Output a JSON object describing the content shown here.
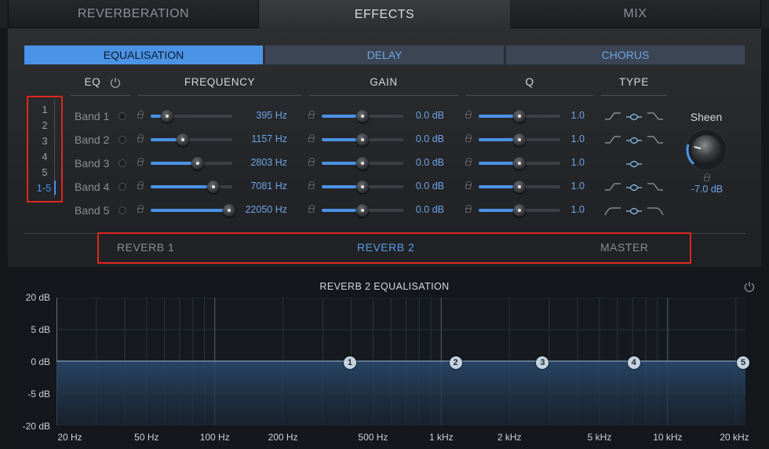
{
  "top_tabs": [
    {
      "label": "REVERBERATION",
      "active": false
    },
    {
      "label": "EFFECTS",
      "active": true
    },
    {
      "label": "MIX",
      "active": false
    }
  ],
  "sub_tabs": [
    {
      "label": "EQUALISATION",
      "active": true
    },
    {
      "label": "DELAY",
      "active": false
    },
    {
      "label": "CHORUS",
      "active": false
    }
  ],
  "columns": {
    "eq": "EQ",
    "frequency": "FREQUENCY",
    "gain": "GAIN",
    "q": "Q",
    "type": "TYPE"
  },
  "band_selector": {
    "items": [
      "1",
      "2",
      "3",
      "4",
      "5",
      "1-5"
    ],
    "selected": "1-5"
  },
  "bands": [
    {
      "label": "Band 1",
      "frequency": "395 Hz",
      "freq_pos": 0.2,
      "gain": "0.0 dB",
      "gain_pos": 0.5,
      "q": "1.0",
      "q_pos": 0.5,
      "types": [
        "low-shelf-icon",
        "peak-icon",
        "high-shelf-icon"
      ],
      "selected_type": 1
    },
    {
      "label": "Band 2",
      "frequency": "1157 Hz",
      "freq_pos": 0.39,
      "gain": "0.0 dB",
      "gain_pos": 0.5,
      "q": "1.0",
      "q_pos": 0.5,
      "types": [
        "low-shelf-icon",
        "peak-icon",
        "high-shelf-icon"
      ],
      "selected_type": 1
    },
    {
      "label": "Band 3",
      "frequency": "2803 Hz",
      "freq_pos": 0.58,
      "gain": "0.0 dB",
      "gain_pos": 0.5,
      "q": "1.0",
      "q_pos": 0.5,
      "types": [
        "peak-icon"
      ],
      "selected_type": 0
    },
    {
      "label": "Band 4",
      "frequency": "7081 Hz",
      "freq_pos": 0.77,
      "gain": "0.0 dB",
      "gain_pos": 0.5,
      "q": "1.0",
      "q_pos": 0.5,
      "types": [
        "low-shelf-icon",
        "peak-icon",
        "high-shelf-icon"
      ],
      "selected_type": 1
    },
    {
      "label": "Band 5",
      "frequency": "22050 Hz",
      "freq_pos": 0.96,
      "gain": "0.0 dB",
      "gain_pos": 0.5,
      "q": "1.0",
      "q_pos": 0.5,
      "types": [
        "low-cut-icon",
        "peak-icon",
        "high-cut-icon"
      ],
      "selected_type": 1
    }
  ],
  "sheen": {
    "label": "Sheen",
    "value": "-7.0 dB",
    "level": 0.22
  },
  "reverb_tabs": [
    {
      "label": "REVERB 1",
      "active": false
    },
    {
      "label": "REVERB 2",
      "active": true
    },
    {
      "label": "MASTER",
      "active": false
    }
  ],
  "graph": {
    "title": "REVERB 2 EQUALISATION",
    "y_ticks": [
      "20 dB",
      "5 dB",
      "0 dB",
      "-5 dB",
      "-20 dB"
    ],
    "x_ticks": [
      "20 Hz",
      "50 Hz",
      "100 Hz",
      "200 Hz",
      "500 Hz",
      "1 kHz",
      "2 kHz",
      "5 kHz",
      "10 kHz",
      "20 kHz"
    ],
    "nodes": [
      "1",
      "2",
      "3",
      "4",
      "5"
    ],
    "accent": "#4a93e6"
  }
}
